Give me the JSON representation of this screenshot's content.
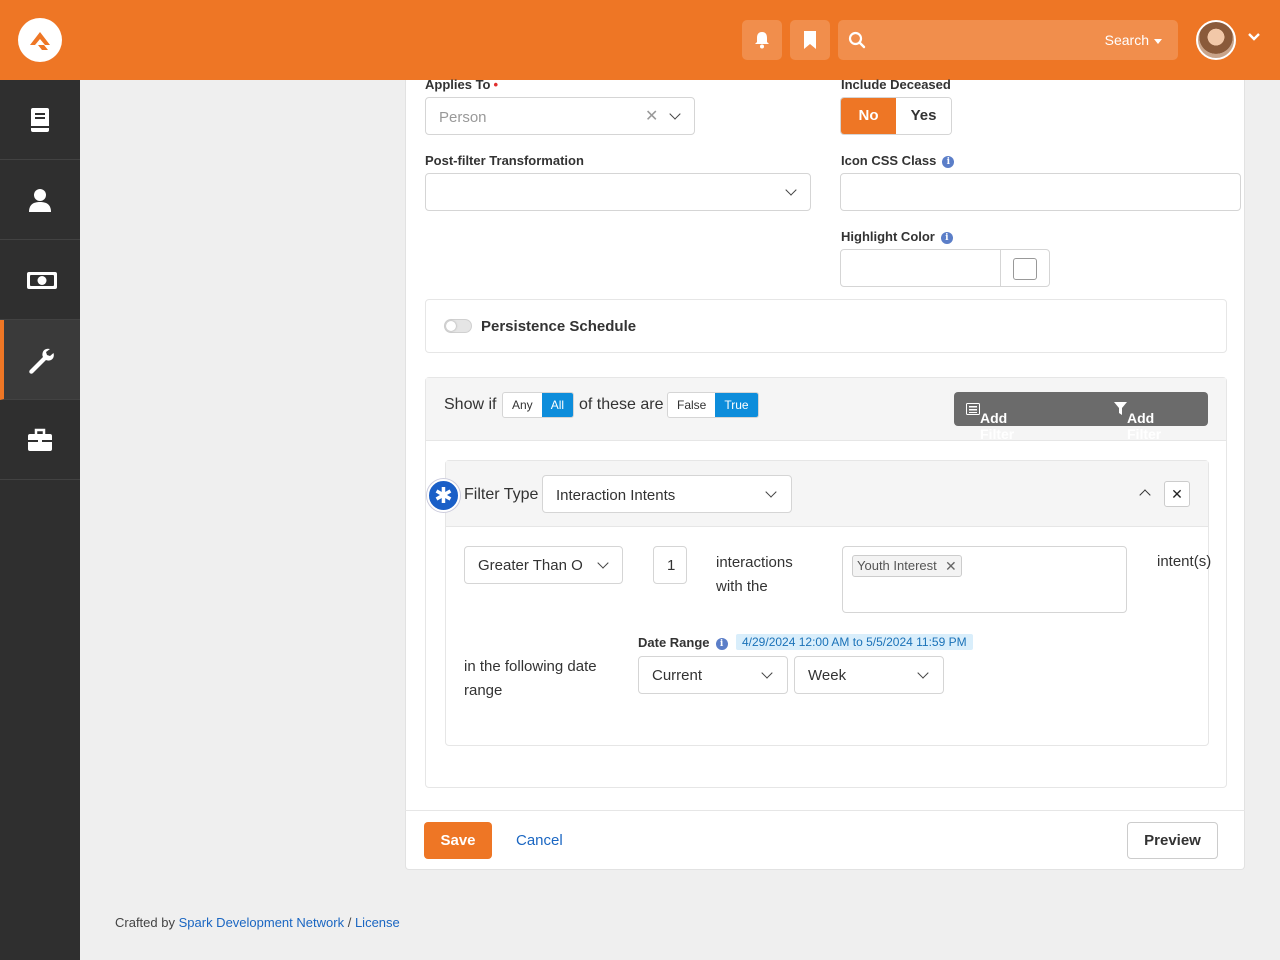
{
  "header": {
    "search_label": "Search"
  },
  "form": {
    "applies_to": {
      "label": "Applies To",
      "required_mark": "•",
      "value": "Person"
    },
    "include_deceased": {
      "label": "Include Deceased",
      "options": [
        "No",
        "Yes"
      ],
      "selected": "No"
    },
    "post_filter": {
      "label": "Post-filter Transformation",
      "value": ""
    },
    "icon_css": {
      "label": "Icon CSS Class",
      "value": ""
    },
    "highlight_color": {
      "label": "Highlight Color",
      "value": ""
    },
    "persistence": {
      "label": "Persistence Schedule",
      "enabled": false
    }
  },
  "filter": {
    "show_if": "Show if",
    "any_all": [
      "Any",
      "All"
    ],
    "any_all_selected": "All",
    "of_these_are": "of these are",
    "true_false": [
      "False",
      "True"
    ],
    "true_false_selected": "True",
    "add_group_label": "Add Filter Group",
    "add_filter_label": "Add Filter",
    "filter_type_label": "Filter Type",
    "filter_type_value": "Interaction Intents",
    "comparison_value": "Greater Than O",
    "count_value": "1",
    "interactions_text": "interactions with the",
    "intent_tag": "Youth Interest",
    "intent_suffix": "intent(s)",
    "date_range_text": "in the following date range",
    "date_range_label": "Date Range",
    "date_range_display": "4/29/2024 12:00 AM to 5/5/2024 11:59 PM",
    "date_period": "Current",
    "date_unit": "Week"
  },
  "actions": {
    "save": "Save",
    "cancel": "Cancel",
    "preview": "Preview"
  },
  "footer": {
    "prefix": "Crafted by",
    "org_link": "Spark Development Network",
    "separator": "/",
    "license_link": "License"
  },
  "colors": {
    "brand_orange": "#ee7625",
    "sidebar_dark": "#2f2f2f",
    "accent_blue": "#0d8ddb",
    "link_blue": "#1a66c2"
  }
}
